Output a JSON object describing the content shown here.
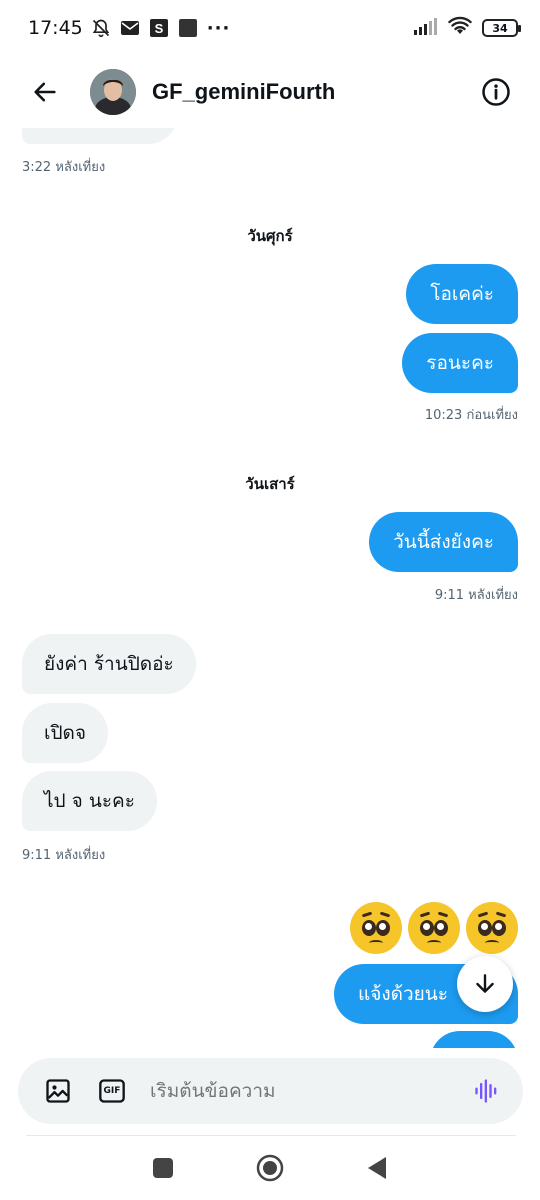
{
  "status_bar": {
    "time": "17:45",
    "battery": "34",
    "icons": [
      "notifications-off-icon",
      "mail-icon",
      "s-app-icon",
      "square-app-icon",
      "more-icon",
      "signal-icon",
      "wifi-icon",
      "battery-icon"
    ],
    "more": "···"
  },
  "header": {
    "contact_name": "GF_geminiFourth",
    "icons": [
      "back-arrow-icon",
      "avatar",
      "info-icon"
    ]
  },
  "conversation": {
    "ts_top": "3:22 หลังเที่ยง",
    "date_friday": "วันศุกร์",
    "out_ok": "โอเคค่ะ",
    "out_wait": "รอนะคะ",
    "ts_friday": "10:23 ก่อนเที่ยง",
    "date_saturday": "วันเสาร์",
    "out_sent_today": "วันนี้ส่งยังคะ",
    "ts_sat_out": "9:11 หลังเที่ยง",
    "in_not_yet": "ยังค่า ร้านปิดอ่ะ",
    "in_open": "เปิดจ",
    "in_go": "ไป จ นะคะ",
    "ts_sat_in": "9:11 หลังเที่ยง",
    "emoji_label": "pleading-face",
    "out_notify": "แจ้งด้วยนะ"
  },
  "composer": {
    "placeholder": "เริ่มต้นข้อความ",
    "gif_label": "GIF"
  },
  "colors": {
    "accent": "#1d9bf0",
    "incoming_bubble": "#eff3f4",
    "voice": "#7856ff"
  }
}
